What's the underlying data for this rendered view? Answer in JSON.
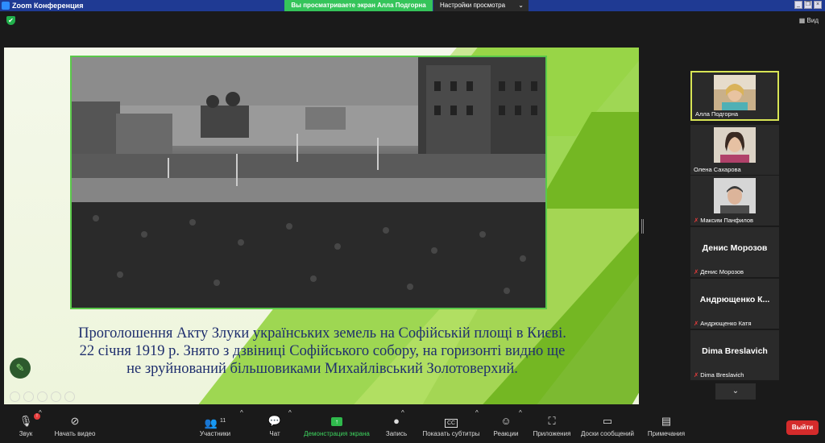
{
  "titlebar": {
    "title": "Zoom Конференция"
  },
  "banner": {
    "viewing": "Вы просматриваете экран Алла Подгорна",
    "view_options": "Настройки просмотра",
    "view_options_chevron": "⌄"
  },
  "window_controls": {
    "minimize": "_",
    "restore": "❐",
    "close": "×"
  },
  "view_button": "Вид",
  "slide": {
    "caption_lines": [
      "Проголошення Акту Злуки українських земель на Софійській площі в Києві.",
      "22 січня 1919 р. Знято з дзвіниці Софійського собору, на горизонті видно ще",
      "не зруйнований більшовиками Михайлівський Золотоверхий."
    ]
  },
  "participants": [
    {
      "name": "Алла Подгорна",
      "has_video": true,
      "active": true,
      "muted": false
    },
    {
      "name": "Олена Сахарова",
      "has_video": true,
      "active": false,
      "muted": false
    },
    {
      "name": "Максим Панфилов",
      "has_video": true,
      "active": false,
      "muted": true
    },
    {
      "name": "Денис Морозов",
      "display": "Денис Морозов",
      "has_video": false,
      "muted": true
    },
    {
      "name": "Андрющенко Катя",
      "display": "Андрющенко К...",
      "has_video": false,
      "muted": true
    },
    {
      "name": "Dima Breslavich",
      "display": "Dima Breslavich",
      "has_video": false,
      "muted": true
    }
  ],
  "toolbar": {
    "audio": "Звук",
    "audio_badge": "!",
    "video": "Начать видео",
    "participants": "Участники",
    "participants_count": "11",
    "chat": "Чат",
    "share": "Демонстрация экрана",
    "record": "Запись",
    "captions": "Показать субтитры",
    "captions_icon_text": "CC",
    "reactions": "Реакции",
    "apps": "Приложения",
    "whiteboard": "Доски сообщений",
    "notes": "Примечания",
    "leave": "Выйти"
  },
  "colors": {
    "titlebar": "#1f3a93",
    "banner_green": "#35c45a",
    "active_border": "#d7e455",
    "leave": "#d42b2b",
    "caption_text": "#1f2f6e"
  }
}
